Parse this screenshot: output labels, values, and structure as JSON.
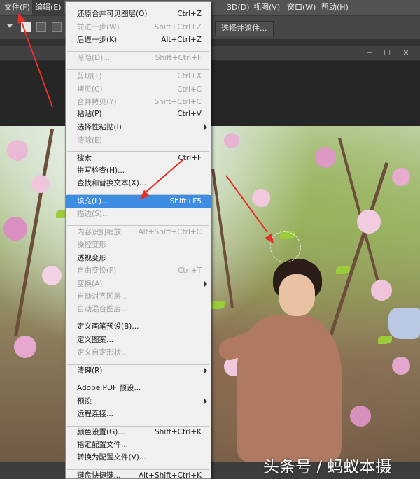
{
  "menubar": {
    "items": [
      "文件(F)",
      "编辑(E)",
      "3D(D)",
      "视图(V)",
      "窗口(W)",
      "帮助(H)"
    ],
    "active": "编辑(E)"
  },
  "options_bar": {
    "select_mask_label": "选择并遮住..."
  },
  "window_controls": {
    "minimize": "─",
    "restore": "☐",
    "close": "✕"
  },
  "edit_menu": {
    "items": [
      {
        "label": "还原合并可见图层(O)",
        "shortcut": "Ctrl+Z",
        "enabled": true
      },
      {
        "label": "前进一步(W)",
        "shortcut": "Shift+Ctrl+Z",
        "enabled": false
      },
      {
        "label": "后退一步(K)",
        "shortcut": "Alt+Ctrl+Z",
        "enabled": true
      },
      {
        "label": "渐隐(D)...",
        "shortcut": "Shift+Ctrl+F",
        "enabled": false
      },
      {
        "label": "剪切(T)",
        "shortcut": "Ctrl+X",
        "enabled": false
      },
      {
        "label": "拷贝(C)",
        "shortcut": "Ctrl+C",
        "enabled": false
      },
      {
        "label": "合并拷贝(Y)",
        "shortcut": "Shift+Ctrl+C",
        "enabled": false
      },
      {
        "label": "粘贴(P)",
        "shortcut": "Ctrl+V",
        "enabled": true
      },
      {
        "label": "选择性粘贴(I)",
        "shortcut": "",
        "enabled": true,
        "submenu": true
      },
      {
        "label": "清除(E)",
        "shortcut": "",
        "enabled": false
      },
      {
        "label": "搜索",
        "shortcut": "Ctrl+F",
        "enabled": true
      },
      {
        "label": "拼写检查(H)...",
        "shortcut": "",
        "enabled": true
      },
      {
        "label": "查找和替换文本(X)...",
        "shortcut": "",
        "enabled": true
      },
      {
        "label": "填充(L)...",
        "shortcut": "Shift+F5",
        "enabled": true,
        "highlighted": true
      },
      {
        "label": "描边(S)...",
        "shortcut": "",
        "enabled": false
      },
      {
        "label": "内容识别缩放",
        "shortcut": "Alt+Shift+Ctrl+C",
        "enabled": false
      },
      {
        "label": "操控变形",
        "shortcut": "",
        "enabled": false
      },
      {
        "label": "透视变形",
        "shortcut": "",
        "enabled": true
      },
      {
        "label": "自由变换(F)",
        "shortcut": "Ctrl+T",
        "enabled": false
      },
      {
        "label": "变换(A)",
        "shortcut": "",
        "enabled": false,
        "submenu": true
      },
      {
        "label": "自动对齐图层...",
        "shortcut": "",
        "enabled": false
      },
      {
        "label": "自动混合图层...",
        "shortcut": "",
        "enabled": false
      },
      {
        "label": "定义画笔预设(B)...",
        "shortcut": "",
        "enabled": true
      },
      {
        "label": "定义图案...",
        "shortcut": "",
        "enabled": true
      },
      {
        "label": "定义自定形状...",
        "shortcut": "",
        "enabled": false
      },
      {
        "label": "清理(R)",
        "shortcut": "",
        "enabled": true,
        "submenu": true
      },
      {
        "label": "Adobe PDF 预设...",
        "shortcut": "",
        "enabled": true
      },
      {
        "label": "预设",
        "shortcut": "",
        "enabled": true,
        "submenu": true
      },
      {
        "label": "远程连接...",
        "shortcut": "",
        "enabled": true
      },
      {
        "label": "颜色设置(G)...",
        "shortcut": "Shift+Ctrl+K",
        "enabled": true
      },
      {
        "label": "指定配置文件...",
        "shortcut": "",
        "enabled": true
      },
      {
        "label": "转换为配置文件(V)...",
        "shortcut": "",
        "enabled": true
      },
      {
        "label": "键盘快捷键...",
        "shortcut": "Alt+Shift+Ctrl+K",
        "enabled": true
      }
    ]
  },
  "watermark": "头条号 / 蚂蚁本摄",
  "colors": {
    "highlight": "#3d8ee2",
    "arrow": "#e8302b",
    "menubar": "#535353"
  }
}
